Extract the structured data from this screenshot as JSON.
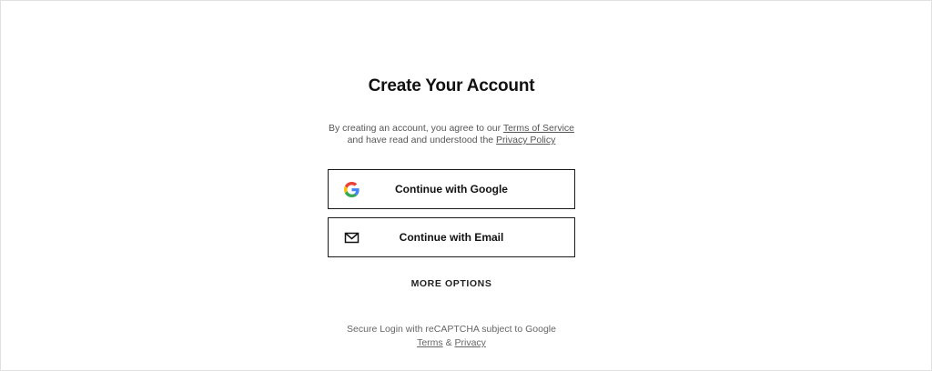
{
  "header": {
    "title": "Create Your Account"
  },
  "agreement": {
    "line1_prefix": "By creating an account, you agree to our ",
    "terms_link": "Terms of Service",
    "line2_prefix": "and have read and understood the ",
    "privacy_link": "Privacy Policy"
  },
  "buttons": {
    "google_label": "Continue with Google",
    "google_icon": "google-g-icon",
    "email_label": "Continue with Email",
    "email_icon": "envelope-icon"
  },
  "more_options": "MORE OPTIONS",
  "recaptcha": {
    "text": "Secure Login with reCAPTCHA subject to Google",
    "terms_link": "Terms",
    "separator": " & ",
    "privacy_link": "Privacy"
  },
  "colors": {
    "border": "#1a1a1a",
    "text": "#111111",
    "muted": "#555555",
    "google_blue": "#4285F4",
    "google_red": "#EA4335",
    "google_yellow": "#FBBC05",
    "google_green": "#34A853"
  }
}
